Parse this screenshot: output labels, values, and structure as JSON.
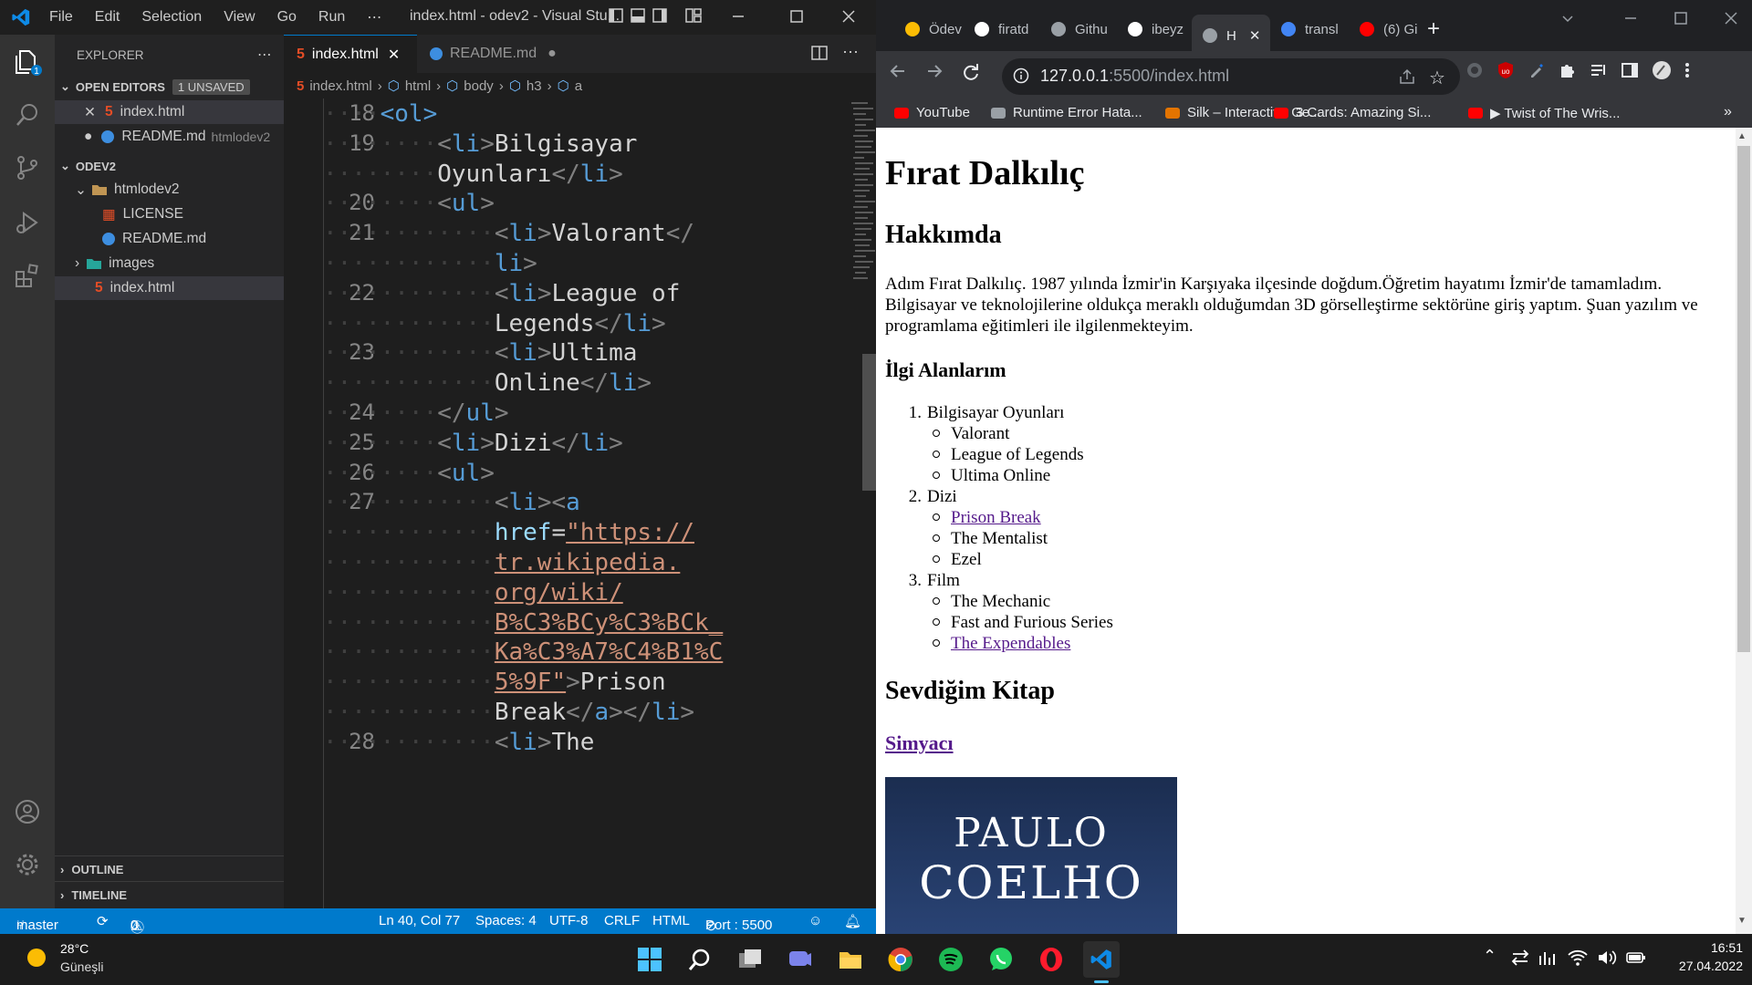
{
  "vscode": {
    "menu": [
      "File",
      "Edit",
      "Selection",
      "View",
      "Go",
      "Run",
      "⋯"
    ],
    "window_title": "index.html - odev2 - Visual Stu...",
    "explorer": {
      "title": "EXPLORER",
      "open_editors_label": "OPEN EDITORS",
      "unsaved_badge": "1 UNSAVED",
      "open_files": [
        {
          "name": "index.html",
          "extra": ""
        },
        {
          "name": "README.md",
          "extra": "htmlodev2"
        }
      ],
      "workspace": "ODEV2",
      "folder": "htmlodev2",
      "files": [
        "LICENSE",
        "README.md"
      ],
      "images_folder": "images",
      "index_file": "index.html",
      "outline": "OUTLINE",
      "timeline": "TIMELINE"
    },
    "tabs": [
      {
        "label": "index.html"
      },
      {
        "label": "README.md"
      }
    ],
    "breadcrumb": [
      "index.html",
      "html",
      "body",
      "h3",
      "a"
    ],
    "code_lines": [
      {
        "n": "18",
        "indent": 1,
        "parts": [
          [
            "t",
            "<"
          ],
          [
            "t",
            "ol"
          ],
          [
            "t",
            ">"
          ]
        ]
      },
      {
        "n": "19",
        "indent": 2,
        "parts": [
          [
            "b",
            "<"
          ],
          [
            "t",
            "li"
          ],
          [
            "b",
            ">"
          ],
          [
            "x",
            "Bilgisayar"
          ]
        ]
      },
      {
        "n": "",
        "indent": 2,
        "parts": [
          [
            "x",
            "Oyunları"
          ],
          [
            "b",
            "</"
          ],
          [
            "t",
            "li"
          ],
          [
            "b",
            ">"
          ]
        ]
      },
      {
        "n": "20",
        "indent": 2,
        "parts": [
          [
            "b",
            "<"
          ],
          [
            "t",
            "ul"
          ],
          [
            "b",
            ">"
          ]
        ]
      },
      {
        "n": "21",
        "indent": 3,
        "parts": [
          [
            "b",
            "<"
          ],
          [
            "t",
            "li"
          ],
          [
            "b",
            ">"
          ],
          [
            "x",
            "Valorant"
          ],
          [
            "b",
            "</"
          ]
        ]
      },
      {
        "n": "",
        "indent": 3,
        "parts": [
          [
            "t",
            "li"
          ],
          [
            "b",
            ">"
          ]
        ]
      },
      {
        "n": "22",
        "indent": 3,
        "parts": [
          [
            "b",
            "<"
          ],
          [
            "t",
            "li"
          ],
          [
            "b",
            ">"
          ],
          [
            "x",
            "League of"
          ]
        ]
      },
      {
        "n": "",
        "indent": 3,
        "parts": [
          [
            "x",
            "Legends"
          ],
          [
            "b",
            "</"
          ],
          [
            "t",
            "li"
          ],
          [
            "b",
            ">"
          ]
        ]
      },
      {
        "n": "23",
        "indent": 3,
        "parts": [
          [
            "b",
            "<"
          ],
          [
            "t",
            "li"
          ],
          [
            "b",
            ">"
          ],
          [
            "x",
            "Ultima"
          ]
        ]
      },
      {
        "n": "",
        "indent": 3,
        "parts": [
          [
            "x",
            "Online"
          ],
          [
            "b",
            "</"
          ],
          [
            "t",
            "li"
          ],
          [
            "b",
            ">"
          ]
        ]
      },
      {
        "n": "24",
        "indent": 2,
        "parts": [
          [
            "b",
            "</"
          ],
          [
            "t",
            "ul"
          ],
          [
            "b",
            ">"
          ]
        ]
      },
      {
        "n": "25",
        "indent": 2,
        "parts": [
          [
            "b",
            "<"
          ],
          [
            "t",
            "li"
          ],
          [
            "b",
            ">"
          ],
          [
            "x",
            "Dizi"
          ],
          [
            "b",
            "</"
          ],
          [
            "t",
            "li"
          ],
          [
            "b",
            ">"
          ]
        ]
      },
      {
        "n": "26",
        "indent": 2,
        "parts": [
          [
            "b",
            "<"
          ],
          [
            "t",
            "ul"
          ],
          [
            "b",
            ">"
          ]
        ]
      },
      {
        "n": "27",
        "indent": 3,
        "parts": [
          [
            "b",
            "<"
          ],
          [
            "t",
            "li"
          ],
          [
            "b",
            "><"
          ],
          [
            "t",
            "a"
          ]
        ]
      },
      {
        "n": "",
        "indent": 3,
        "parts": [
          [
            "at",
            "href"
          ],
          [
            "x",
            "="
          ],
          [
            "s",
            "\"https://"
          ]
        ]
      },
      {
        "n": "",
        "indent": 3,
        "parts": [
          [
            "s",
            "tr.wikipedia."
          ]
        ]
      },
      {
        "n": "",
        "indent": 3,
        "parts": [
          [
            "s",
            "org/wiki/"
          ]
        ]
      },
      {
        "n": "",
        "indent": 3,
        "parts": [
          [
            "s",
            "B%C3%BCy%C3%BCk_"
          ]
        ]
      },
      {
        "n": "",
        "indent": 3,
        "parts": [
          [
            "s",
            "Ka%C3%A7%C4%B1%C"
          ]
        ]
      },
      {
        "n": "",
        "indent": 3,
        "parts": [
          [
            "s",
            "5%9F\""
          ],
          [
            "b",
            ">"
          ],
          [
            "x",
            "Prison"
          ]
        ]
      },
      {
        "n": "",
        "indent": 3,
        "parts": [
          [
            "x",
            "Break"
          ],
          [
            "b",
            "</"
          ],
          [
            "t",
            "a"
          ],
          [
            "b",
            "></"
          ],
          [
            "t",
            "li"
          ],
          [
            "b",
            ">"
          ]
        ]
      },
      {
        "n": "28",
        "indent": 3,
        "parts": [
          [
            "b",
            "<"
          ],
          [
            "t",
            "li"
          ],
          [
            "b",
            ">"
          ],
          [
            "x",
            "The"
          ]
        ]
      }
    ],
    "status": {
      "branch": "master",
      "errors": "0",
      "warnings": "0",
      "position": "Ln 40, Col 77",
      "spaces": "Spaces: 4",
      "encoding": "UTF-8",
      "eol": "CRLF",
      "language": "HTML",
      "port": "Port : 5500"
    }
  },
  "chrome": {
    "tabs": [
      "Ödev",
      "firatd",
      "Githu",
      "ibeyz",
      "H",
      "transl",
      "(6) Gi"
    ],
    "url_host": "127.0.0.1",
    "url_rest": ":5500/index.html",
    "bookmarks": [
      "YouTube",
      "Runtime Error Hata...",
      "Silk – Interactive Ge...",
      "3 Cards: Amazing Si...",
      "▶ Twist of The Wris..."
    ]
  },
  "page": {
    "h1": "Fırat Dalkılıç",
    "about_heading": "Hakkımda",
    "about_text": "Adım Fırat Dalkılıç. 1987 yılında İzmir'in Karşıyaka ilçesinde doğdum.Öğretim hayatımı İzmir'de tamamladım. Bilgisayar ve teknolojilerine oldukça meraklı olduğumdan 3D görselleştirme sektörüne giriş yaptım. Şuan yazılım ve programlama eğitimleri ile ilgilenmekteyim.",
    "interests_heading": "İlgi Alanlarım",
    "list": [
      {
        "num": "1.",
        "label": "Bilgisayar Oyunları",
        "items": [
          {
            "t": "Valorant",
            "link": false
          },
          {
            "t": "League of Legends",
            "link": false
          },
          {
            "t": "Ultima Online",
            "link": false
          }
        ]
      },
      {
        "num": "2.",
        "label": "Dizi",
        "items": [
          {
            "t": "Prison Break",
            "link": true
          },
          {
            "t": "The Mentalist",
            "link": false
          },
          {
            "t": "Ezel",
            "link": false
          }
        ]
      },
      {
        "num": "3.",
        "label": "Film",
        "items": [
          {
            "t": "The Mechanic",
            "link": false
          },
          {
            "t": "Fast and Furious Series",
            "link": false
          },
          {
            "t": "The Expendables",
            "link": true
          }
        ]
      }
    ],
    "book_heading": "Sevdiğim Kitap",
    "book_link": "Simyacı",
    "book_cover": {
      "line1": "PAULO",
      "line2": "COELHO"
    }
  },
  "taskbar": {
    "temp": "28°C",
    "weather": "Güneşli",
    "time": "16:51",
    "date": "27.04.2022"
  },
  "colors": {
    "vscode_accent": "#007acc",
    "chrome_bg": "#35363a",
    "link": "#551a8b"
  }
}
